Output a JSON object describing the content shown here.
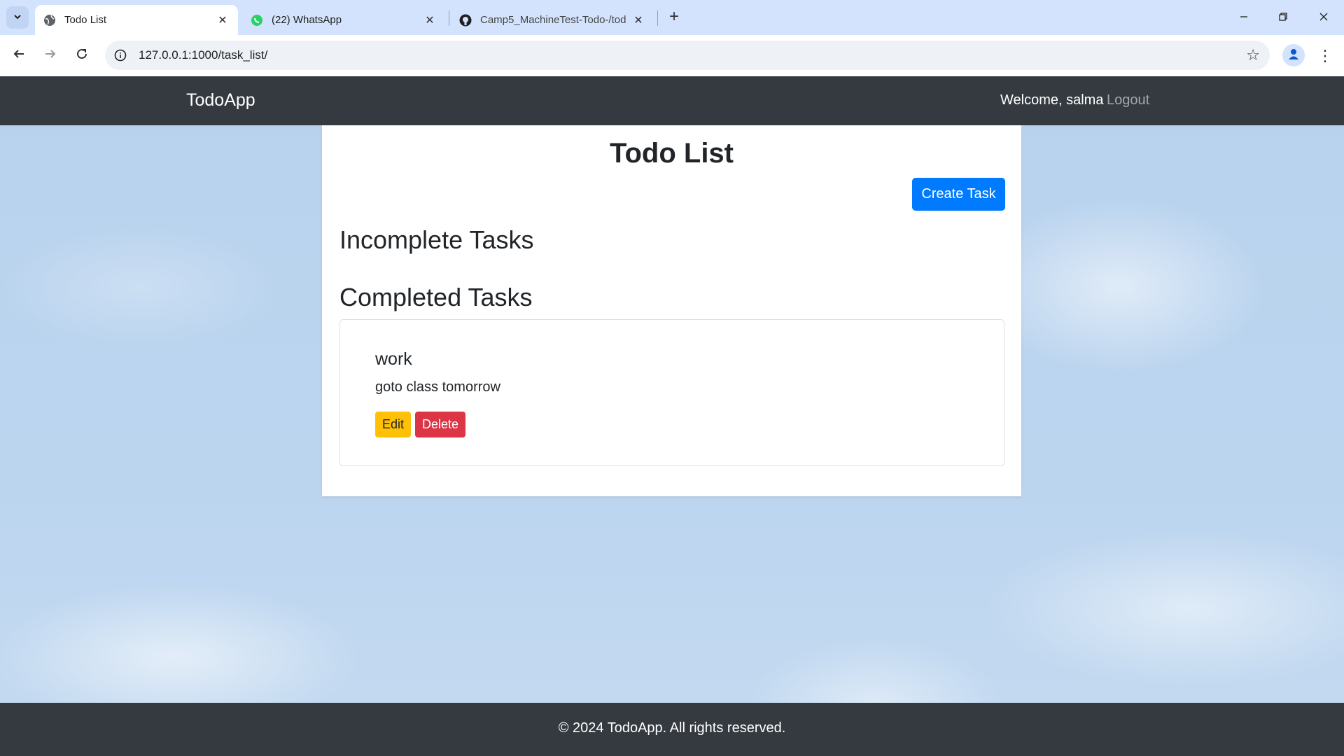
{
  "browser": {
    "tabs": [
      {
        "title": "Todo List",
        "icon": "globe-icon",
        "active": true
      },
      {
        "title": "(22) WhatsApp",
        "icon": "whatsapp-icon",
        "active": false
      },
      {
        "title": "Camp5_MachineTest-Todo-/tod",
        "icon": "github-icon",
        "active": false
      }
    ],
    "url": "127.0.0.1:1000/task_list/"
  },
  "navbar": {
    "brand": "TodoApp",
    "welcome": "Welcome, salma",
    "logout": "Logout"
  },
  "main": {
    "title": "Todo List",
    "create_button": "Create Task",
    "incomplete_heading": "Incomplete Tasks",
    "completed_heading": "Completed Tasks",
    "completed_tasks": [
      {
        "title": "work",
        "description": "goto class tomorrow",
        "edit_label": "Edit",
        "delete_label": "Delete"
      }
    ]
  },
  "footer": {
    "text": "© 2024 TodoApp. All rights reserved."
  },
  "colors": {
    "navbar": "#343a40",
    "primary": "#007bff",
    "warning": "#ffc107",
    "danger": "#dc3545"
  }
}
